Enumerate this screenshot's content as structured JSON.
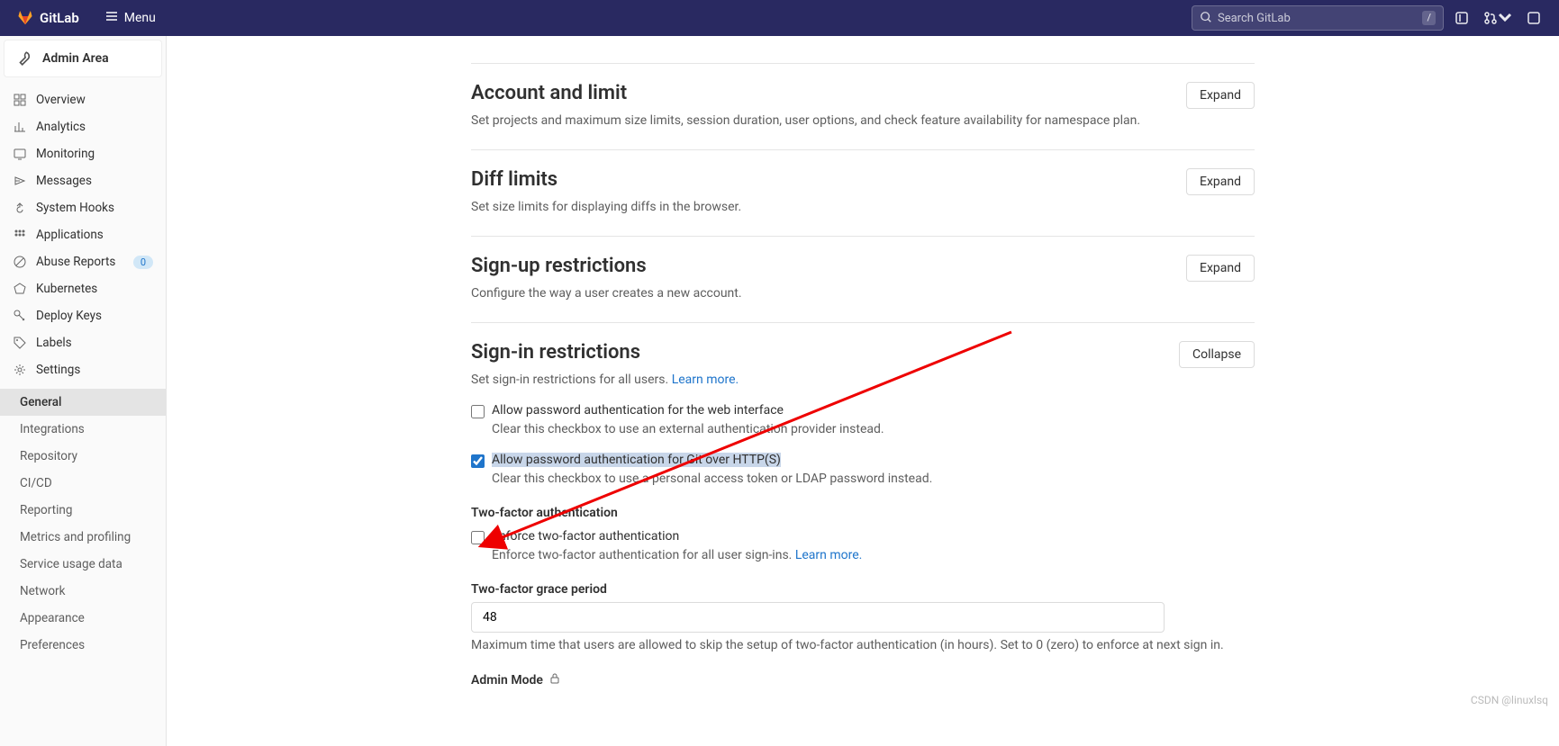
{
  "topbar": {
    "brand": "GitLab",
    "menu_label": "Menu",
    "search_placeholder": "Search GitLab",
    "search_kbd": "/"
  },
  "context": {
    "title": "Admin Area"
  },
  "sidebar": {
    "items": [
      {
        "label": "Overview",
        "icon": "overview"
      },
      {
        "label": "Analytics",
        "icon": "analytics"
      },
      {
        "label": "Monitoring",
        "icon": "monitoring"
      },
      {
        "label": "Messages",
        "icon": "messages"
      },
      {
        "label": "System Hooks",
        "icon": "hook"
      },
      {
        "label": "Applications",
        "icon": "apps"
      },
      {
        "label": "Abuse Reports",
        "icon": "abuse",
        "badge": "0"
      },
      {
        "label": "Kubernetes",
        "icon": "k8s"
      },
      {
        "label": "Deploy Keys",
        "icon": "key"
      },
      {
        "label": "Labels",
        "icon": "label"
      },
      {
        "label": "Settings",
        "icon": "settings"
      }
    ],
    "settings_sub": [
      {
        "label": "General",
        "active": true
      },
      {
        "label": "Integrations"
      },
      {
        "label": "Repository"
      },
      {
        "label": "CI/CD"
      },
      {
        "label": "Reporting"
      },
      {
        "label": "Metrics and profiling"
      },
      {
        "label": "Service usage data"
      },
      {
        "label": "Network"
      },
      {
        "label": "Appearance"
      },
      {
        "label": "Preferences"
      }
    ]
  },
  "sections": {
    "account": {
      "title": "Account and limit",
      "desc": "Set projects and maximum size limits, session duration, user options, and check feature availability for namespace plan.",
      "btn": "Expand"
    },
    "diff": {
      "title": "Diff limits",
      "desc": "Set size limits for displaying diffs in the browser.",
      "btn": "Expand"
    },
    "signup": {
      "title": "Sign-up restrictions",
      "desc": "Configure the way a user creates a new account.",
      "btn": "Expand"
    },
    "signin": {
      "title": "Sign-in restrictions",
      "desc_pre": "Set sign-in restrictions for all users. ",
      "desc_link": "Learn more.",
      "btn": "Collapse",
      "chk1_label": "Allow password authentication for the web interface",
      "chk1_help": "Clear this checkbox to use an external authentication provider instead.",
      "chk2_label": "Allow password authentication for Git over HTTP(S)",
      "chk2_help": "Clear this checkbox to use a personal access token or LDAP password instead.",
      "tfa_h": "Two-factor authentication",
      "tfa_chk_label": "Enforce two-factor authentication",
      "tfa_chk_help_pre": "Enforce two-factor authentication for all user sign-ins. ",
      "tfa_chk_help_link": "Learn more.",
      "grace_label": "Two-factor grace period",
      "grace_value": "48",
      "grace_help": "Maximum time that users are allowed to skip the setup of two-factor authentication (in hours). Set to 0 (zero) to enforce at next sign in.",
      "admin_h": "Admin Mode"
    }
  },
  "watermark": "CSDN @linuxlsq"
}
